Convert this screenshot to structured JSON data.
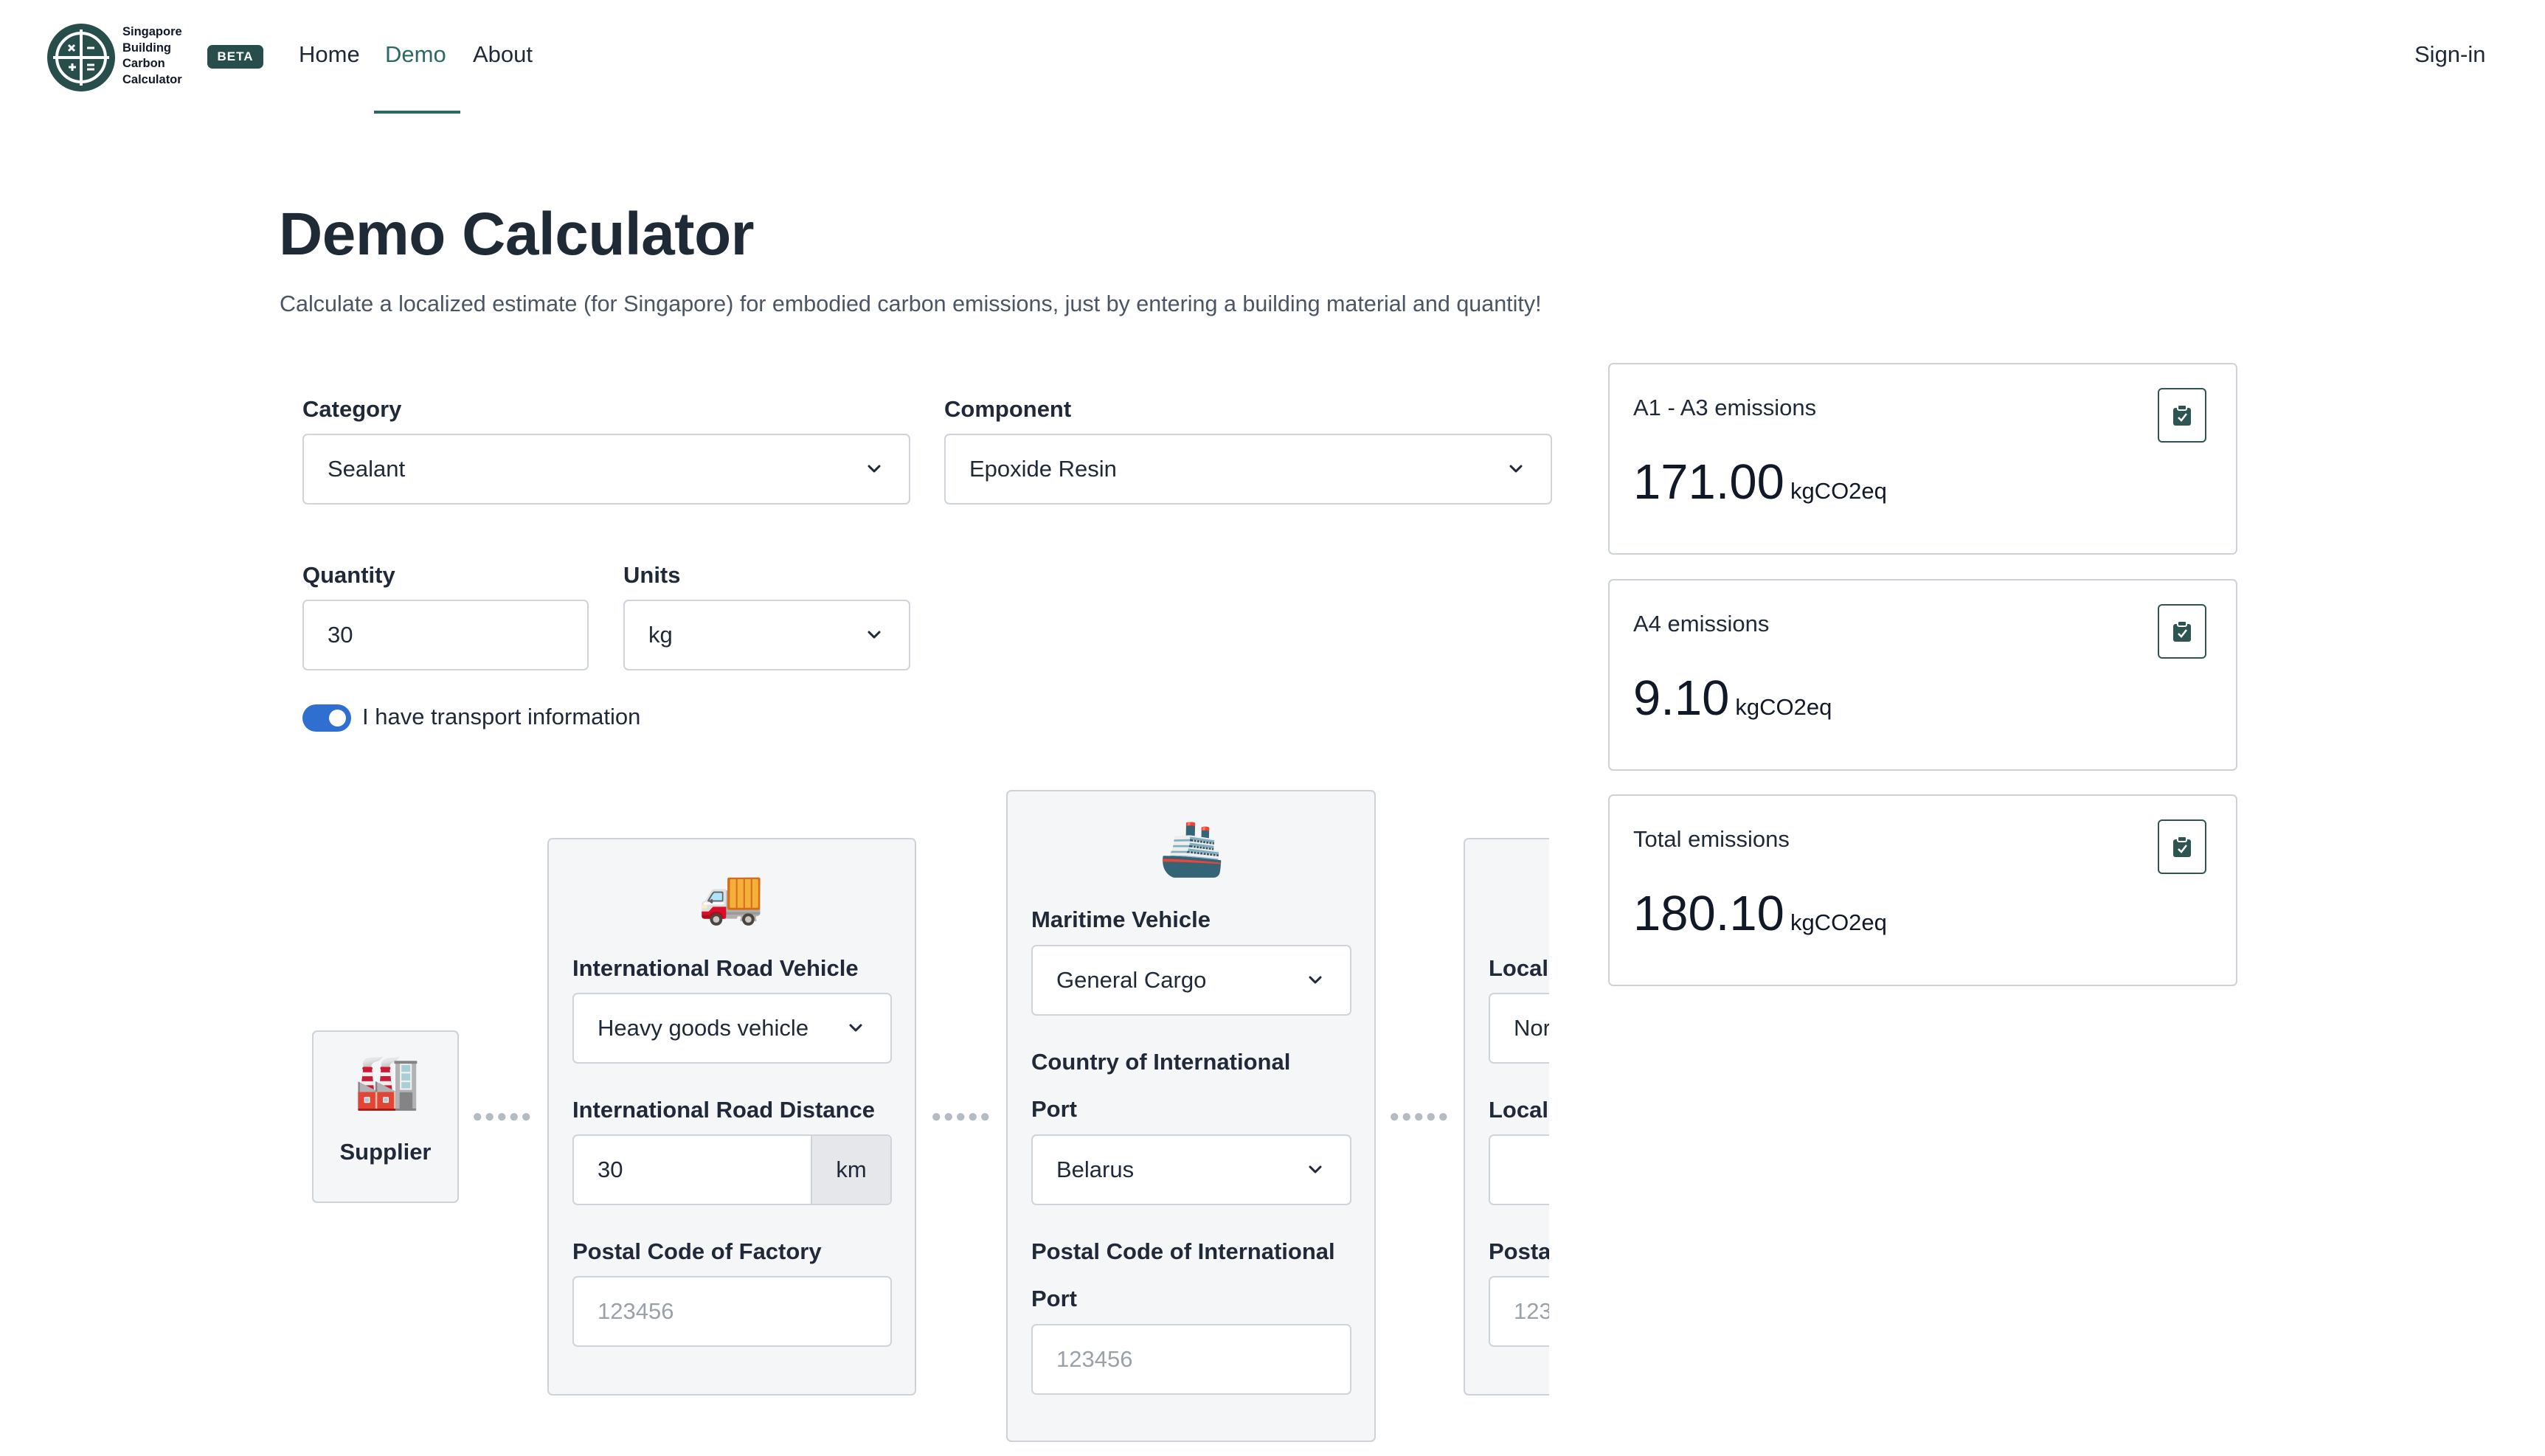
{
  "nav": {
    "logo_text": [
      "Singapore",
      "Building",
      "Carbon",
      "Calculator"
    ],
    "badge": "BETA",
    "links": [
      "Home",
      "Demo",
      "About"
    ],
    "active": "Demo",
    "signin": "Sign-in"
  },
  "header": {
    "title": "Demo Calculator",
    "subtitle": "Calculate a localized estimate (for Singapore) for embodied carbon emissions, just by entering a building material and quantity!"
  },
  "form": {
    "category": {
      "label": "Category",
      "value": "Sealant"
    },
    "component": {
      "label": "Component",
      "value": "Epoxide Resin"
    },
    "quantity": {
      "label": "Quantity",
      "value": "30"
    },
    "units": {
      "label": "Units",
      "value": "kg"
    },
    "transport_toggle": {
      "label": "I have transport information",
      "on": true
    }
  },
  "transport": {
    "supplier": {
      "label": "Supplier",
      "emoji": "🏭"
    },
    "road": {
      "emoji": "🚚",
      "vehicle_label": "International Road Vehicle",
      "vehicle_value": "Heavy goods vehicle",
      "distance_label": "International Road Distance",
      "distance_value": "30",
      "distance_unit": "km",
      "postal_label": "Postal Code of Factory",
      "postal_placeholder": "123456"
    },
    "maritime": {
      "emoji": "🚢",
      "vehicle_label": "Maritime Vehicle",
      "vehicle_value": "General Cargo",
      "country_label_1": "Country of International",
      "country_label_2": "Port",
      "country_value": "Belarus",
      "postal_label_1": "Postal Code of International",
      "postal_label_2": "Port",
      "postal_placeholder": "123456"
    },
    "local": {
      "vehicle_label": "Local",
      "vehicle_value": "Nor",
      "distance_label": "Local",
      "postal_label": "Posta",
      "postal_placeholder": "123"
    }
  },
  "emissions": [
    {
      "title": "A1 - A3 emissions",
      "value": "171.00",
      "unit": "kgCO2eq"
    },
    {
      "title": "A4 emissions",
      "value": "9.10",
      "unit": "kgCO2eq"
    },
    {
      "title": "Total emissions",
      "value": "180.10",
      "unit": "kgCO2eq"
    }
  ],
  "icons": {
    "logo": "calculator-globe-logo",
    "dropdown": "chevron-down-icon",
    "copy": "clipboard-icon"
  },
  "colors": {
    "brand": "#274e4a",
    "active_link": "#2a6a62",
    "toggle_on": "#2f6fd0",
    "border": "#cfd4da",
    "card_bg": "#f5f6f7"
  }
}
